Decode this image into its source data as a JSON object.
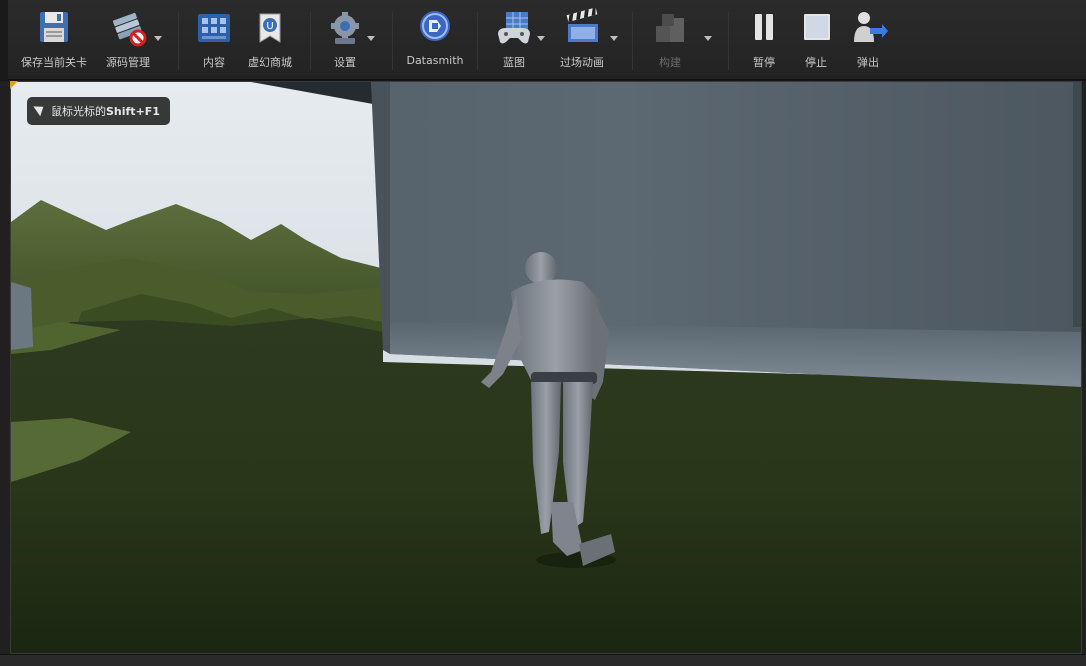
{
  "toolbar": {
    "buttons": [
      {
        "label": "保存当前关卡",
        "icon": "floppy-save-icon",
        "dropdown": false,
        "enabled": true
      },
      {
        "label": "源码管理",
        "icon": "source-control-icon",
        "dropdown": true,
        "enabled": true
      },
      {
        "label": "内容",
        "icon": "content-browser-icon",
        "dropdown": false,
        "enabled": true
      },
      {
        "label": "虚幻商城",
        "icon": "marketplace-icon",
        "dropdown": false,
        "enabled": true
      },
      {
        "label": "设置",
        "icon": "settings-gear-icon",
        "dropdown": true,
        "enabled": true
      },
      {
        "label": "Datasmith",
        "icon": "datasmith-icon",
        "dropdown": false,
        "enabled": true
      },
      {
        "label": "蓝图",
        "icon": "blueprint-gamepad-icon",
        "dropdown": true,
        "enabled": true
      },
      {
        "label": "过场动画",
        "icon": "clapperboard-icon",
        "dropdown": true,
        "enabled": true
      },
      {
        "label": "构建",
        "icon": "build-blocks-icon",
        "dropdown": true,
        "enabled": false
      },
      {
        "label": "暂停",
        "icon": "pause-icon",
        "dropdown": false,
        "enabled": true
      },
      {
        "label": "停止",
        "icon": "stop-icon",
        "dropdown": false,
        "enabled": true
      },
      {
        "label": "弹出",
        "icon": "eject-user-icon",
        "dropdown": false,
        "enabled": true
      }
    ]
  },
  "viewport": {
    "hint_prefix": "鼠标光标的",
    "hint_keys": "Shift+F1",
    "hint_icon": "cursor-arrow-icon"
  },
  "colors": {
    "toolbar_bg": "#262626",
    "label_text": "#c8c8c8",
    "disabled_text": "#6a6a6a",
    "accent_corner": "#e0a400"
  }
}
